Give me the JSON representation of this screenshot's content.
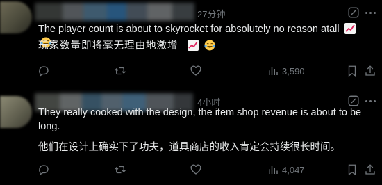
{
  "posts": [
    {
      "timestamp": "27分钟",
      "text_en": "The player count is about to skyrocket for absolutely no reason atall",
      "text_zh": "玩家数量即将毫无理由地激增",
      "views": "3,590"
    },
    {
      "timestamp": "4小时",
      "text_en": "They really cooked with the design, the item shop revenue is about to be long.",
      "text_zh": "他们在设计上确实下了功夫，道具商店的收入肯定会持续很长时间。",
      "views": "4,047"
    }
  ],
  "colors": {
    "background": "#000000",
    "text": "#e7e9ea",
    "muted": "#71767b",
    "divider": "#2f3336"
  },
  "icons": [
    "grok-icon",
    "more-icon",
    "reply-icon",
    "repost-icon",
    "like-icon",
    "views-icon",
    "bookmark-icon",
    "share-icon",
    "chart-increasing-emoji",
    "tears-of-joy-emoji"
  ]
}
